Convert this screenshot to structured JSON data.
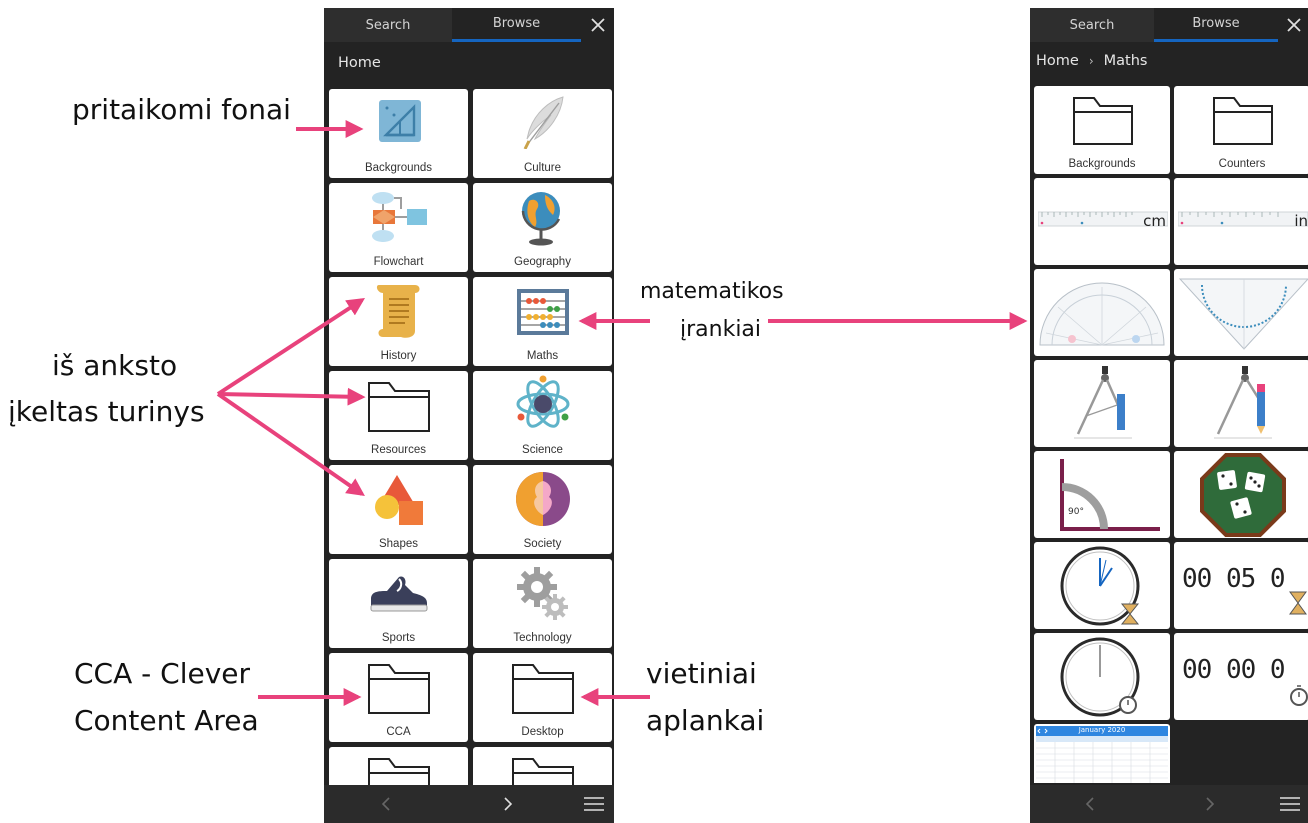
{
  "left_panel": {
    "tabs": [
      "Search",
      "Browse"
    ],
    "active_tab": "Browse",
    "breadcrumb": [
      "Home"
    ],
    "items": [
      {
        "label": "Backgrounds",
        "icon": "backgrounds-icon"
      },
      {
        "label": "Culture",
        "icon": "quill-icon"
      },
      {
        "label": "Flowchart",
        "icon": "flowchart-icon"
      },
      {
        "label": "Geography",
        "icon": "globe-icon"
      },
      {
        "label": "History",
        "icon": "scroll-icon"
      },
      {
        "label": "Maths",
        "icon": "abacus-icon"
      },
      {
        "label": "Resources",
        "icon": "folder-icon"
      },
      {
        "label": "Science",
        "icon": "atom-icon"
      },
      {
        "label": "Shapes",
        "icon": "shapes-icon"
      },
      {
        "label": "Society",
        "icon": "faces-icon"
      },
      {
        "label": "Sports",
        "icon": "sneaker-icon"
      },
      {
        "label": "Technology",
        "icon": "gears-icon"
      },
      {
        "label": "CCA",
        "icon": "folder-icon"
      },
      {
        "label": "Desktop",
        "icon": "folder-icon"
      },
      {
        "label": "",
        "icon": "folder-icon"
      },
      {
        "label": "",
        "icon": "folder-icon"
      }
    ]
  },
  "right_panel": {
    "tabs": [
      "Search",
      "Browse"
    ],
    "active_tab": "Browse",
    "breadcrumb": [
      "Home",
      "Maths"
    ],
    "items": [
      {
        "label": "Backgrounds",
        "icon": "folder-icon"
      },
      {
        "label": "Counters",
        "icon": "folder-icon"
      },
      {
        "label": "cm",
        "icon": "ruler-cm-icon"
      },
      {
        "label": "in",
        "icon": "ruler-in-icon"
      },
      {
        "label": "",
        "icon": "protractor-icon"
      },
      {
        "label": "",
        "icon": "set-square-icon"
      },
      {
        "label": "",
        "icon": "compass-icon"
      },
      {
        "label": "",
        "icon": "compass-pencil-icon"
      },
      {
        "label": "90°",
        "icon": "right-angle-icon"
      },
      {
        "label": "",
        "icon": "dice-icon"
      },
      {
        "label": "",
        "icon": "clock-hourglass-icon"
      },
      {
        "label": "00 05 0",
        "icon": "digital-timer-icon"
      },
      {
        "label": "",
        "icon": "clock-stopwatch-icon"
      },
      {
        "label": "00 00 0",
        "icon": "digital-stopwatch-icon"
      },
      {
        "label": "January 2020",
        "icon": "calendar-icon"
      }
    ]
  },
  "annotations": {
    "backgrounds": "pritaikomi fonai",
    "preloaded_line1": "iš anksto",
    "preloaded_line2": "įkeltas turinys",
    "maths_line1": "matematikos",
    "maths_line2": "įrankiai",
    "cca_line1": "CCA - Clever",
    "cca_line2": "Content Area",
    "local_line1": "vietiniai",
    "local_line2": "aplankai"
  },
  "colors": {
    "panel_bg": "#232323",
    "tab_active_underline": "#1565c0",
    "arrow": "#e8427c"
  }
}
